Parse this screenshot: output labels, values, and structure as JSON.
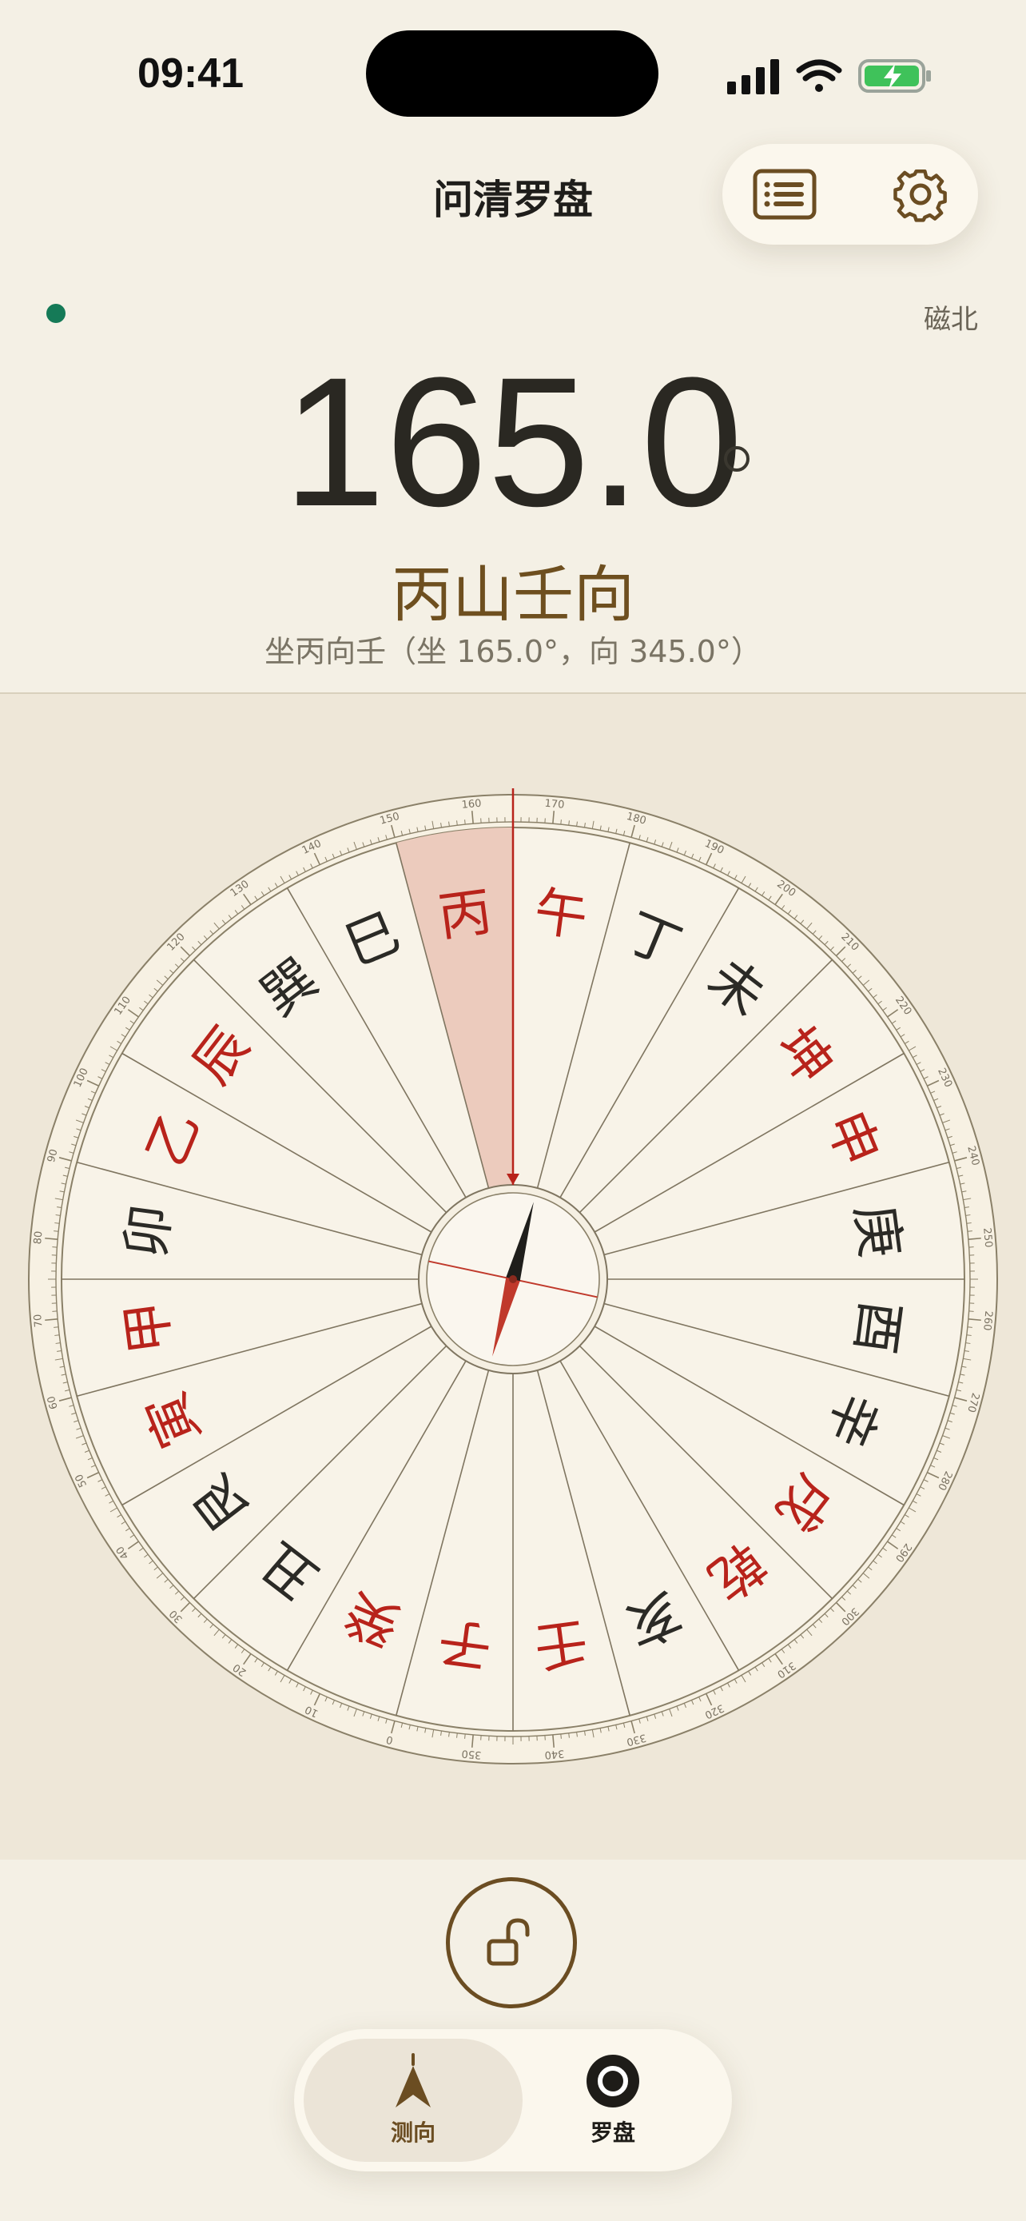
{
  "status_bar": {
    "time": "09:41"
  },
  "header": {
    "title": "问清罗盘"
  },
  "readout": {
    "north_mode": "磁北",
    "heading": "165.0",
    "mountain_name": "丙山壬向",
    "mountain_detail": "坐丙向壬（坐 165.0°，向 345.0°）"
  },
  "compass": {
    "heading_deg": 165.0,
    "highlighted_mountain": "丙",
    "mountains": [
      {
        "name": "巳",
        "center_deg": 142.5,
        "color": "#2b2a26"
      },
      {
        "name": "丙",
        "center_deg": 157.5,
        "color": "#b8231b"
      },
      {
        "name": "午",
        "center_deg": 172.5,
        "color": "#b8231b"
      },
      {
        "name": "丁",
        "center_deg": 187.5,
        "color": "#2b2a26"
      },
      {
        "name": "未",
        "center_deg": 202.5,
        "color": "#2b2a26"
      },
      {
        "name": "坤",
        "center_deg": 217.5,
        "color": "#b8231b"
      },
      {
        "name": "申",
        "center_deg": 232.5,
        "color": "#b8231b"
      },
      {
        "name": "庚",
        "center_deg": 247.5,
        "color": "#2b2a26"
      },
      {
        "name": "酉",
        "center_deg": 262.5,
        "color": "#2b2a26"
      },
      {
        "name": "辛",
        "center_deg": 277.5,
        "color": "#2b2a26"
      },
      {
        "name": "戌",
        "center_deg": 292.5,
        "color": "#b8231b"
      },
      {
        "name": "乾",
        "center_deg": 307.5,
        "color": "#b8231b"
      },
      {
        "name": "亥",
        "center_deg": 322.5,
        "color": "#2b2a26"
      },
      {
        "name": "壬",
        "center_deg": 337.5,
        "color": "#b8231b"
      },
      {
        "name": "子",
        "center_deg": 352.5,
        "color": "#b8231b"
      },
      {
        "name": "癸",
        "center_deg": 7.5,
        "color": "#b8231b"
      },
      {
        "name": "丑",
        "center_deg": 22.5,
        "color": "#2b2a26"
      },
      {
        "name": "艮",
        "center_deg": 37.5,
        "color": "#2b2a26"
      },
      {
        "name": "寅",
        "center_deg": 52.5,
        "color": "#b8231b"
      },
      {
        "name": "甲",
        "center_deg": 67.5,
        "color": "#b8231b"
      },
      {
        "name": "卯",
        "center_deg": 82.5,
        "color": "#2b2a26"
      },
      {
        "name": "乙",
        "center_deg": 97.5,
        "color": "#b8231b"
      },
      {
        "name": "辰",
        "center_deg": 112.5,
        "color": "#b8231b"
      },
      {
        "name": "巽",
        "center_deg": 127.5,
        "color": "#2b2a26"
      }
    ],
    "degree_labels": [
      "0",
      "10",
      "20",
      "30",
      "40",
      "50",
      "60",
      "70",
      "80",
      "90",
      "100",
      "110",
      "120",
      "130",
      "140",
      "150",
      "160",
      "170",
      "180",
      "190",
      "200",
      "210",
      "220",
      "230",
      "240",
      "250",
      "260",
      "270",
      "280",
      "290",
      "300",
      "310",
      "320",
      "330",
      "340",
      "350"
    ]
  },
  "tabs": [
    {
      "label": "测向",
      "icon": "direction-arrow-icon",
      "active": true
    },
    {
      "label": "罗盘",
      "icon": "compass-ring-icon",
      "active": false
    }
  ],
  "colors": {
    "accent": "#6b4d22",
    "red": "#b8231b",
    "live": "#157a57"
  }
}
